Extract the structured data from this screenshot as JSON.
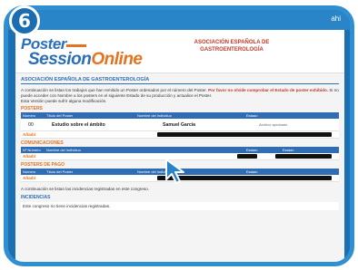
{
  "step": {
    "number": "6"
  },
  "window": {
    "corner_logo": "ahi"
  },
  "brand": {
    "poster": "Poster",
    "session": "Session",
    "online": "Online"
  },
  "header": {
    "org_line1": "ASOCIACIÓN ESPAÑOLA DE",
    "org_line2": "GASTROENTEROLOGÍA"
  },
  "main": {
    "org_title": "ASOCIACIÓN ESPAÑOLA DE GASTROENTEROLOGÍA",
    "intro_line1": "A continuación se listan los trabajos que han remitido un Poster ordenados por el número del Poster.",
    "intro_bold": "Por favor no olvide comprobar el Estado de poster exhibido.",
    "intro_line2": "Si no puede acceder con Nombre a los posters en el siguiente Estado de su producción y actualice el Poster.",
    "intro_line3": "Esta Versión puede sufrir alguna modificación."
  },
  "posters": {
    "label": "POSTERS",
    "headers": [
      "Número",
      "Título del Poster",
      "Nombre del Individuo",
      "Estado"
    ],
    "row": {
      "number": "00",
      "title": "Estudio sobre el ámbito",
      "author": "Samuel García",
      "status": "Archivo aprobado",
      "link": "Añadir"
    }
  },
  "comunicaciones": {
    "label": "COMUNICACIONES",
    "headers": [
      "Nº Número",
      "Nombre del Individuo",
      "Estado",
      "Estado"
    ],
    "row": {
      "link": "Añadir"
    }
  },
  "posters_de_pago": {
    "label": "POSTERS DE PAGO",
    "headers": [
      "Número",
      "Título del Poster",
      "Nombre del Individuo",
      "Estado"
    ],
    "row": {
      "link": "Añadir"
    }
  },
  "footer": {
    "note": "A continuación se listan las incidencias registradas en este congreso.",
    "ack_label": "INCIDENCIAS",
    "ack_text": "Este congreso no tiene incidencias registradas."
  },
  "colors": {
    "frame": "#2f8fd0",
    "header_bar": "#2e6cb5",
    "accent_orange": "#e5731e",
    "accent_red": "#c0392b"
  }
}
